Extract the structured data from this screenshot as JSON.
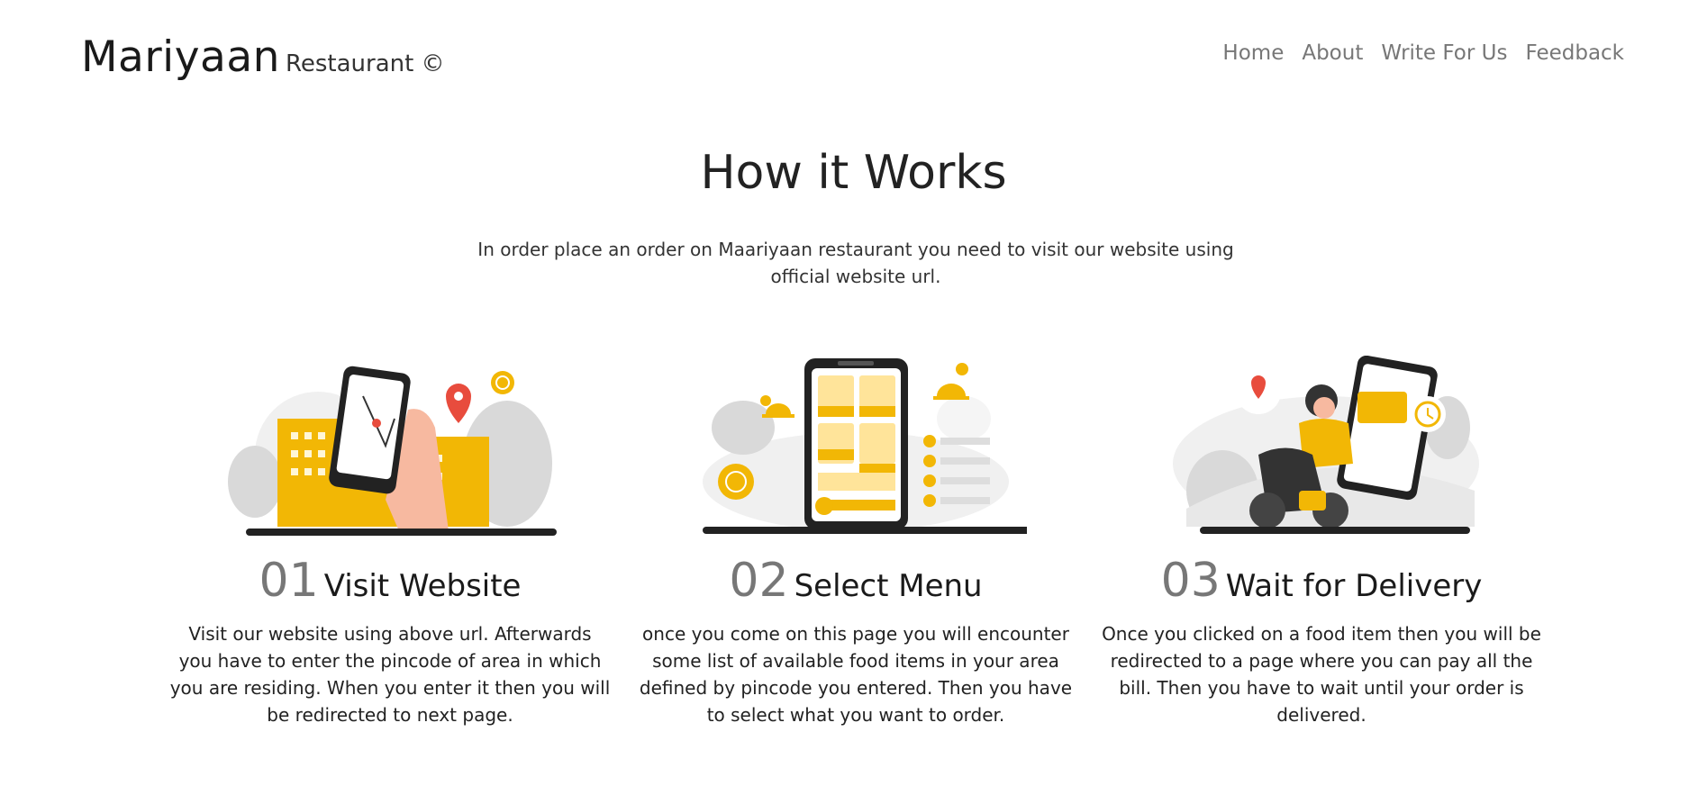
{
  "brand": {
    "name": "Mariyaan",
    "subtitle": "Restaurant ©"
  },
  "nav": {
    "items": [
      "Home",
      "About",
      "Write For Us",
      "Feedback"
    ]
  },
  "hero": {
    "title": "How it Works",
    "description": "In order place an order on Maariyaan restaurant you need to visit our website using official website url."
  },
  "steps": [
    {
      "number": "01",
      "title": "Visit Website",
      "text": "Visit our website using above url. Afterwards you have to enter the pincode of area in which you are residing. When you enter it then you will be redirected to next page.",
      "icon": "phone-map-icon"
    },
    {
      "number": "02",
      "title": "Select Menu",
      "text": "once you come on this page you will encounter some list of available food items in your area defined by pincode you entered. Then you have to select what you want to order.",
      "icon": "menu-phone-icon"
    },
    {
      "number": "03",
      "title": "Wait for Delivery",
      "text": "Once you clicked on a food item then you will be redirected to a page where you can pay all the bill. Then you have to wait until your order is delivered.",
      "icon": "delivery-scooter-icon"
    }
  ],
  "colors": {
    "accent": "#F2B705",
    "pin": "#E84C3D",
    "dark": "#222222",
    "muted": "#777777"
  }
}
